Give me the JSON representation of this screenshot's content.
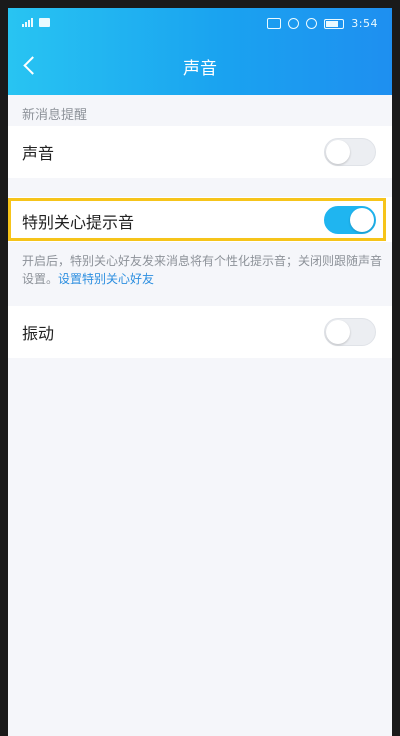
{
  "status_bar": {
    "time": "3:54"
  },
  "header": {
    "title": "声音"
  },
  "section": {
    "label": "新消息提醒"
  },
  "settings": {
    "sound": {
      "label": "声音",
      "enabled": false
    },
    "special_care": {
      "label": "特别关心提示音",
      "enabled": true
    },
    "description": "开启后，特别关心好友发来消息将有个性化提示音；关闭则跟随声音设置。",
    "link_text": "设置特别关心好友",
    "vibrate": {
      "label": "振动",
      "enabled": false
    }
  },
  "colors": {
    "accent": "#1fb5f0",
    "highlight": "#f6c41a"
  }
}
